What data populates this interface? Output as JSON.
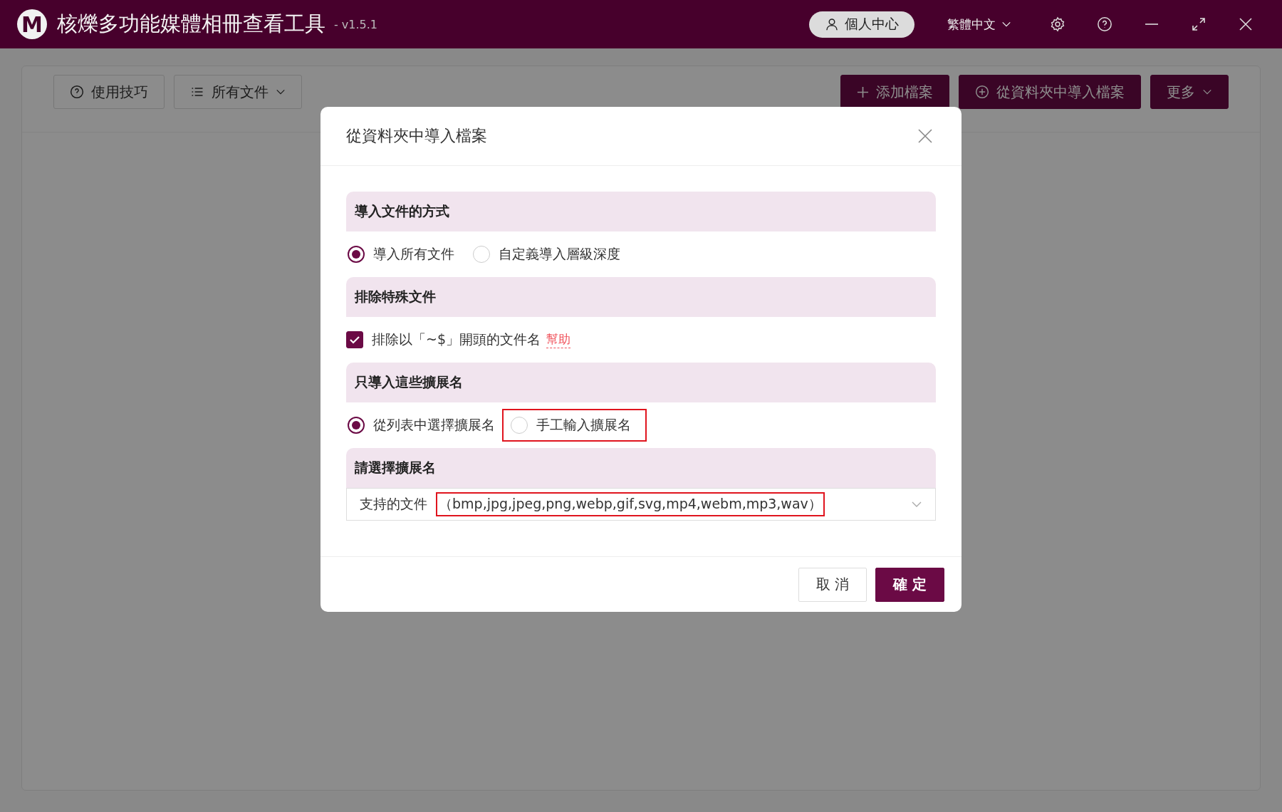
{
  "window": {
    "logo": "M",
    "title": "核爍多功能媒體相冊查看工具",
    "version": "- v1.5.1",
    "user_button": "個人中心",
    "language": "繁體中文"
  },
  "toolbar": {
    "left": [
      {
        "label": "使用技巧",
        "kind": "help"
      },
      {
        "label": "所有文件",
        "kind": "list"
      }
    ],
    "right": [
      {
        "label": "添加檔案",
        "kind": "add"
      },
      {
        "label": "從資料夾中導入檔案",
        "kind": "import"
      },
      {
        "label": "更多",
        "kind": "more"
      }
    ]
  },
  "dialog": {
    "title": "從資料夾中導入檔案",
    "sections": [
      {
        "heading": "導入文件的方式",
        "kind": "radio",
        "options": [
          {
            "label": "導入所有文件",
            "selected": true,
            "highlighted": false
          },
          {
            "label": "自定義導入層級深度",
            "selected": false,
            "highlighted": false
          }
        ]
      },
      {
        "heading": "排除特殊文件",
        "kind": "checkbox",
        "label": "排除以「~$」開頭的文件名",
        "checked": true,
        "link": "幫助"
      },
      {
        "heading": "只導入這些擴展名",
        "kind": "radio",
        "options": [
          {
            "label": "從列表中選擇擴展名",
            "selected": true,
            "highlighted": false
          },
          {
            "label": "手工輸入擴展名",
            "selected": false,
            "highlighted": true
          }
        ]
      },
      {
        "heading": "請選擇擴展名",
        "kind": "select",
        "prefix": "支持的文件",
        "value": "（bmp,jpg,jpeg,png,webp,gif,svg,mp4,webm,mp3,wav）",
        "highlighted": true
      }
    ],
    "buttons": [
      {
        "label": "取 消",
        "primary": false
      },
      {
        "label": "確 定",
        "primary": true
      }
    ]
  }
}
